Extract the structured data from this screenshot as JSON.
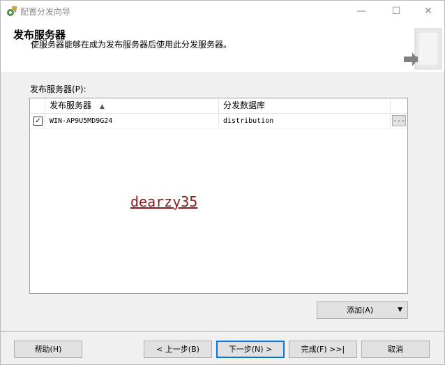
{
  "window": {
    "title": "配置分发向导",
    "minimize_glyph": "—",
    "maximize_glyph": "☐",
    "close_glyph": "✕"
  },
  "header": {
    "title": "发布服务器",
    "description": "使服务器能够在成为发布服务器后使用此分发服务器。"
  },
  "publishers": {
    "label": "发布服务器(P):",
    "columns": [
      "发布服务器",
      "分发数据库"
    ],
    "sort_indicator": "▲",
    "rows": [
      {
        "checked": true,
        "check_glyph": "✓",
        "publisher": "WIN-AP9U5MD9G24",
        "database": "distribution",
        "button_label": "..."
      }
    ]
  },
  "watermark": "dearzy35",
  "add_button": {
    "label": "添加(A)",
    "dropdown_glyph": "▼"
  },
  "footer": {
    "help": "帮助(H)",
    "back": "< 上一步(B)",
    "next": "下一步(N) >",
    "finish": "完成(F) >>|",
    "cancel": "取消"
  }
}
